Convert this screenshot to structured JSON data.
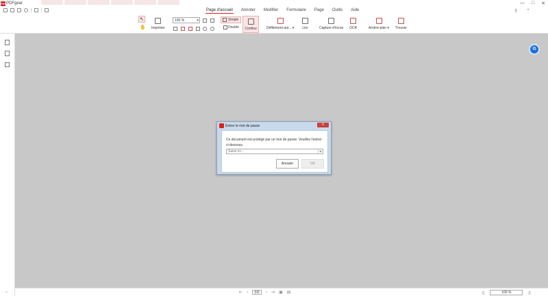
{
  "app": {
    "name": "PDFgear",
    "logo_text": "PDF"
  },
  "menu": {
    "tabs": [
      "Page d'accueil",
      "Annoter",
      "Modifier",
      "Formulaire",
      "Page",
      "Outils",
      "Aide"
    ]
  },
  "ribbon": {
    "print_label": "Imprimer",
    "zoom_value": "100 %",
    "simple_label": "Simple",
    "double_label": "Double",
    "continu_label": "Continu",
    "scroll_label": "Défilement aut... ▾",
    "read_label": "Lire",
    "capture_label": "Capture d'écran",
    "ocr_label": "OCR",
    "background_label": "Arrière-plan ▾",
    "find_label": "Trouver"
  },
  "dialog": {
    "title": "Entrer le mot de passe",
    "close_glyph": "✕",
    "message": "Ce document est protégé par un mot de passe. Veuillez l'entrer ci-dessous.",
    "password_placeholder": "Saisir ici...",
    "cancel_label": "Annuler",
    "ok_label": "OK"
  },
  "status": {
    "page_value": "0/0",
    "zoom_value": "100 %"
  },
  "colors": {
    "accent": "#d9201e",
    "badge": "#1f6fd1",
    "canvas": "#c8c8c8"
  }
}
